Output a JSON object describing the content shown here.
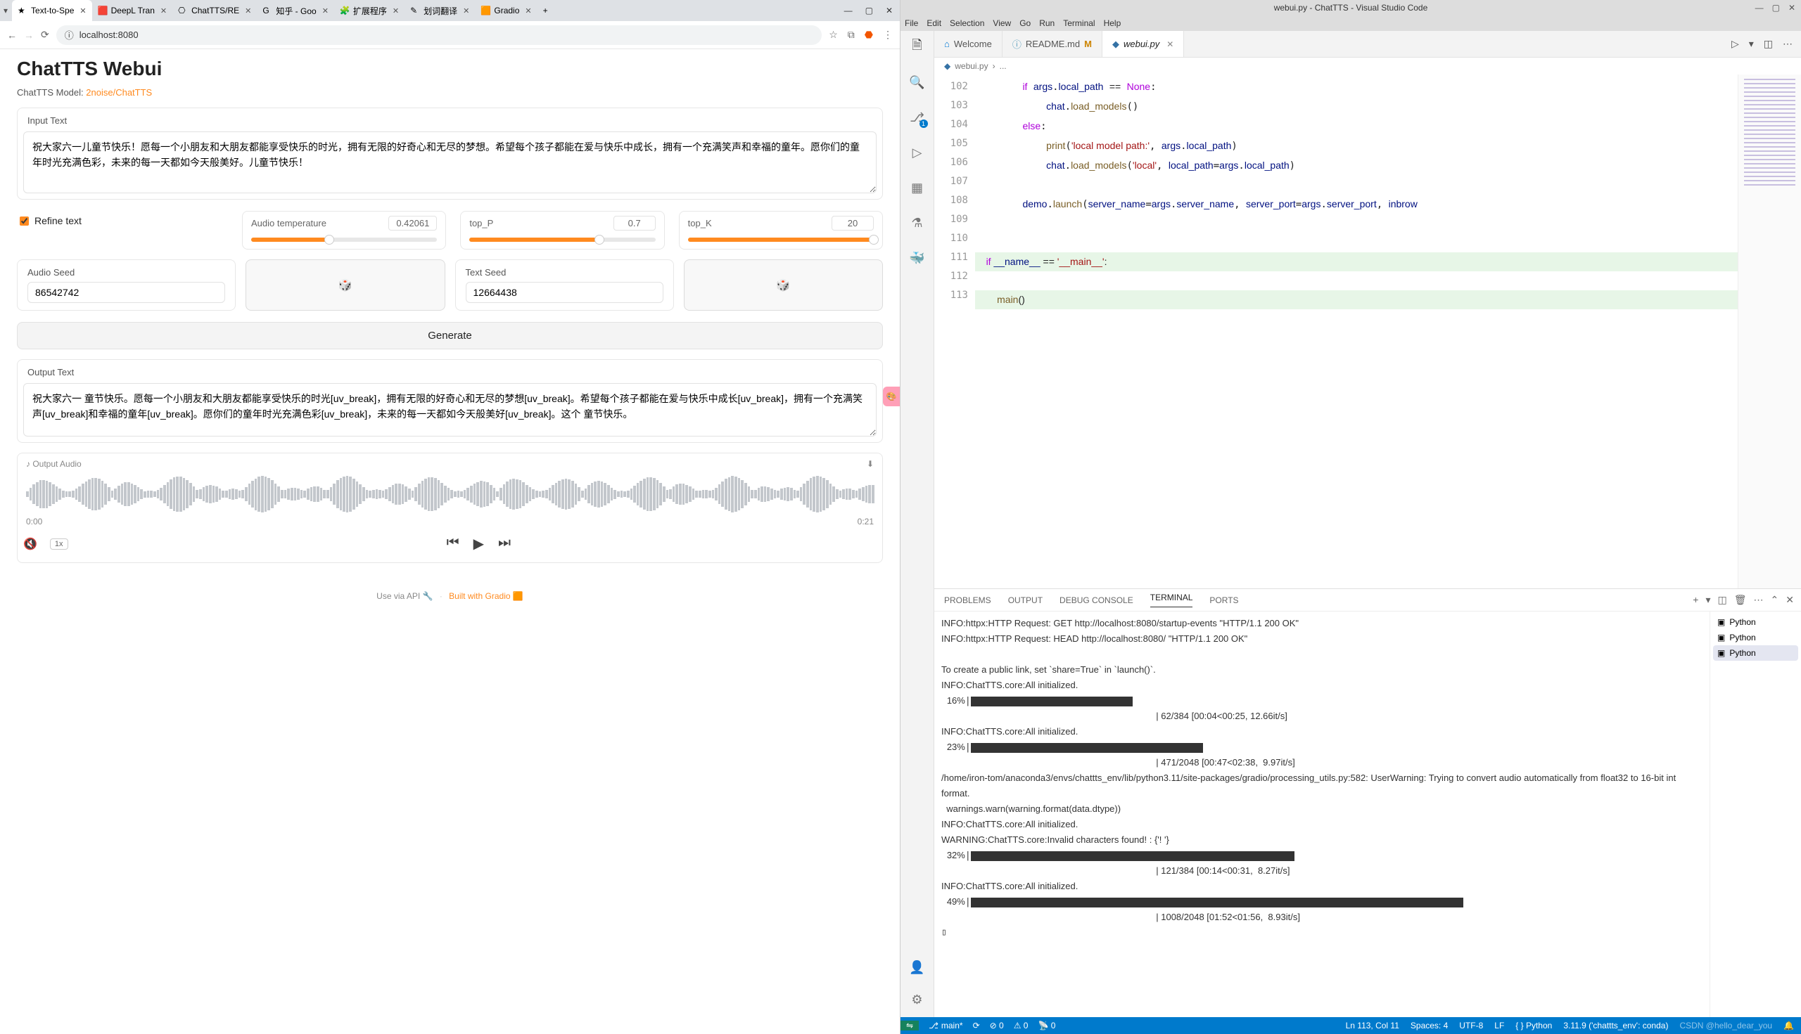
{
  "browser": {
    "tabs": [
      {
        "title": "Text-to-Spe",
        "fav": "★",
        "active": true
      },
      {
        "title": "DeepL Tran",
        "fav": "🟥"
      },
      {
        "title": "ChatTTS/RE",
        "fav": "⎔"
      },
      {
        "title": "知乎 - Goo",
        "fav": "G"
      },
      {
        "title": "扩展程序",
        "fav": "🧩"
      },
      {
        "title": "划词翻译",
        "fav": "✎"
      },
      {
        "title": "Gradio",
        "fav": "🟧"
      }
    ],
    "url": "localhost:8080"
  },
  "page": {
    "title": "ChatTTS Webui",
    "model_label": "ChatTTS Model:",
    "model_link": "2noise/ChatTTS",
    "input_label": "Input Text",
    "input_text": "祝大家六一儿童节快乐！愿每一个小朋友和大朋友都能享受快乐的时光，拥有无限的好奇心和无尽的梦想。希望每个孩子都能在爱与快乐中成长，拥有一个充满笑声和幸福的童年。愿你们的童年时光充满色彩，未来的每一天都如今天般美好。儿童节快乐！",
    "refine_label": "Refine text",
    "sliders": {
      "temperature": {
        "label": "Audio temperature",
        "value": "0.42061",
        "pct": 42
      },
      "top_p": {
        "label": "top_P",
        "value": "0.7",
        "pct": 70
      },
      "top_k": {
        "label": "top_K",
        "value": "20",
        "pct": 100
      }
    },
    "audio_seed": {
      "label": "Audio Seed",
      "value": "86542742"
    },
    "text_seed": {
      "label": "Text Seed",
      "value": "12664438"
    },
    "generate": "Generate",
    "output_label": "Output Text",
    "output_text": "祝大家六一 童节快乐。愿每一个小朋友和大朋友都能享受快乐的时光[uv_break]，拥有无限的好奇心和无尽的梦想[uv_break]。希望每个孩子都能在爱与快乐中成长[uv_break]，拥有一个充满笑声[uv_break]和幸福的童年[uv_break]。愿你们的童年时光充满色彩[uv_break]，未来的每一天都如今天般美好[uv_break]。这个 童节快乐。",
    "audio_label": "Output Audio",
    "time_start": "0:00",
    "time_end": "0:21",
    "rate": "1x",
    "footer_api": "Use via API 🔧",
    "footer_gradio": "Built with Gradio 🟧"
  },
  "vscode": {
    "title": "webui.py - ChatTTS - Visual Studio Code",
    "menu": [
      "File",
      "Edit",
      "Selection",
      "View",
      "Go",
      "Run",
      "Terminal",
      "Help"
    ],
    "tabs": {
      "welcome": "Welcome",
      "readme": "README.md",
      "webui": "webui.py"
    },
    "breadcrumb": {
      "file": "webui.py",
      "sep": "›",
      "more": "..."
    },
    "gutter_start": 102,
    "panel": {
      "tabs": [
        "PROBLEMS",
        "OUTPUT",
        "DEBUG CONSOLE",
        "TERMINAL",
        "PORTS"
      ]
    },
    "terminal": {
      "lines": [
        "INFO:httpx:HTTP Request: GET http://localhost:8080/startup-events \"HTTP/1.1 200 OK\"",
        "INFO:httpx:HTTP Request: HEAD http://localhost:8080/ \"HTTP/1.1 200 OK\"",
        "",
        "To create a public link, set `share=True` in `launch()`.",
        "INFO:ChatTTS.core:All initialized.",
        "",
        "INFO:ChatTTS.core:All initialized.",
        "",
        "/home/iron-tom/anaconda3/envs/chattts_env/lib/python3.11/site-packages/gradio/processing_utils.py:582: UserWarning: Trying to convert audio automatically from float32 to 16-bit int format.",
        "  warnings.warn(warning.format(data.dtype))",
        "INFO:ChatTTS.core:All initialized.",
        "WARNING:ChatTTS.core:Invalid characters found! : {'! '}",
        "",
        "INFO:ChatTTS.core:All initialized.",
        ""
      ],
      "prog": [
        {
          "pct": "16%",
          "barw": 230,
          "right": "| 62/384 [00:04<00:25, 12.66it/s]"
        },
        {
          "pct": "23%",
          "barw": 330,
          "right": "| 471/2048 [00:47<02:38,  9.97it/s]"
        },
        {
          "pct": "32%",
          "barw": 460,
          "right": "| 121/384 [00:14<00:31,  8.27it/s]"
        },
        {
          "pct": "49%",
          "barw": 700,
          "right": "| 1008/2048 [01:52<01:56,  8.93it/s]"
        }
      ],
      "side": [
        "Python",
        "Python",
        "Python"
      ]
    },
    "status": {
      "branch": "main*",
      "sync": "⟳",
      "errors": "⊘ 0",
      "warnings": "⚠ 0",
      "ports": "📡 0",
      "ln": "Ln 113, Col 11",
      "spaces": "Spaces: 4",
      "enc": "UTF-8",
      "eol": "LF",
      "lang": "Python",
      "env": "3.11.9 ('chattts_env': conda)",
      "watermark": "CSDN @hello_dear_you"
    }
  }
}
